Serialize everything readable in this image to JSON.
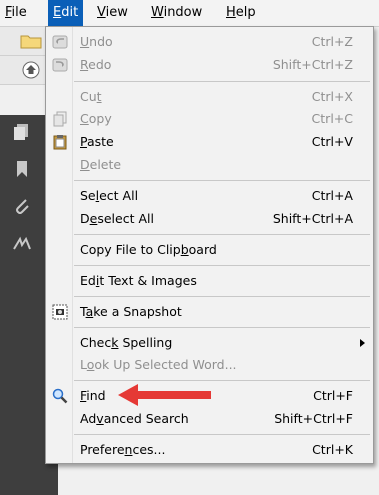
{
  "menubar": {
    "items": [
      {
        "label_pre": "",
        "mnemonic": "F",
        "label_post": "ile"
      },
      {
        "label_pre": "",
        "mnemonic": "E",
        "label_post": "dit"
      },
      {
        "label_pre": "",
        "mnemonic": "V",
        "label_post": "iew"
      },
      {
        "label_pre": "",
        "mnemonic": "W",
        "label_post": "indow"
      },
      {
        "label_pre": "",
        "mnemonic": "H",
        "label_post": "elp"
      }
    ]
  },
  "menu": {
    "undo": {
      "pre": "",
      "mn": "U",
      "post": "ndo",
      "shortcut": "Ctrl+Z"
    },
    "redo": {
      "pre": "",
      "mn": "R",
      "post": "edo",
      "shortcut": "Shift+Ctrl+Z"
    },
    "cut": {
      "pre": "Cu",
      "mn": "t",
      "post": "",
      "shortcut": "Ctrl+X"
    },
    "copy": {
      "pre": "",
      "mn": "C",
      "post": "opy",
      "shortcut": "Ctrl+C"
    },
    "paste": {
      "pre": "",
      "mn": "P",
      "post": "aste",
      "shortcut": "Ctrl+V"
    },
    "delete": {
      "pre": "",
      "mn": "D",
      "post": "elete"
    },
    "select_all": {
      "pre": "Se",
      "mn": "l",
      "post": "ect All",
      "shortcut": "Ctrl+A"
    },
    "deselect_all": {
      "pre": "D",
      "mn": "e",
      "post": "select All",
      "shortcut": "Shift+Ctrl+A"
    },
    "copy_file": {
      "pre": "Copy File to Clip",
      "mn": "b",
      "post": "oard"
    },
    "edit_text": {
      "pre": "Ed",
      "mn": "i",
      "post": "t Text & Images"
    },
    "snapshot": {
      "pre": "T",
      "mn": "a",
      "post": "ke a Snapshot"
    },
    "check_spelling": {
      "pre": "Chec",
      "mn": "k",
      "post": " Spelling"
    },
    "look_up": {
      "pre": "L",
      "mn": "o",
      "post": "ok Up Selected Word..."
    },
    "find": {
      "pre": "",
      "mn": "F",
      "post": "ind",
      "shortcut": "Ctrl+F"
    },
    "advanced_search": {
      "pre": "Ad",
      "mn": "v",
      "post": "anced Search",
      "shortcut": "Shift+Ctrl+F"
    },
    "preferences": {
      "pre": "Prefere",
      "mn": "n",
      "post": "ces...",
      "shortcut": "Ctrl+K"
    }
  },
  "colors": {
    "menu_active": "#0a5fb8",
    "annotation_arrow": "#e53935",
    "disabled_text": "#8f8f8f"
  },
  "icons": [
    "folder-icon",
    "home-icon",
    "undo-icon",
    "redo-icon",
    "copy-icon",
    "paste-icon",
    "snapshot-icon",
    "find-icon"
  ]
}
